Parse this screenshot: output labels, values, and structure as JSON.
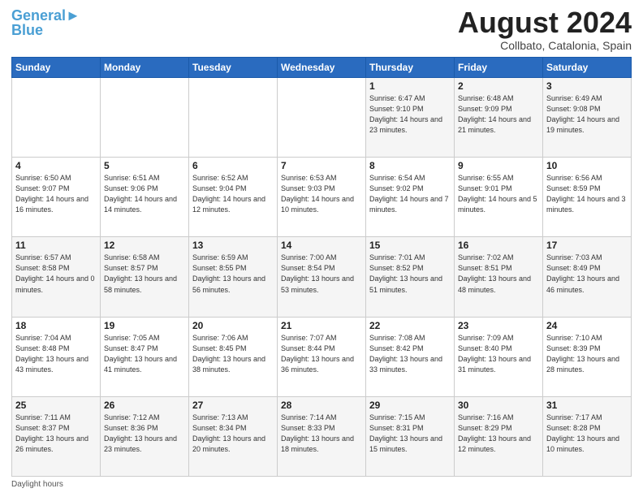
{
  "header": {
    "logo_line1": "General",
    "logo_line2": "Blue",
    "month_title": "August 2024",
    "location": "Collbato, Catalonia, Spain"
  },
  "days_of_week": [
    "Sunday",
    "Monday",
    "Tuesday",
    "Wednesday",
    "Thursday",
    "Friday",
    "Saturday"
  ],
  "weeks": [
    [
      {
        "day": "",
        "sunrise": "",
        "sunset": "",
        "daylight": ""
      },
      {
        "day": "",
        "sunrise": "",
        "sunset": "",
        "daylight": ""
      },
      {
        "day": "",
        "sunrise": "",
        "sunset": "",
        "daylight": ""
      },
      {
        "day": "",
        "sunrise": "",
        "sunset": "",
        "daylight": ""
      },
      {
        "day": "1",
        "sunrise": "Sunrise: 6:47 AM",
        "sunset": "Sunset: 9:10 PM",
        "daylight": "Daylight: 14 hours and 23 minutes."
      },
      {
        "day": "2",
        "sunrise": "Sunrise: 6:48 AM",
        "sunset": "Sunset: 9:09 PM",
        "daylight": "Daylight: 14 hours and 21 minutes."
      },
      {
        "day": "3",
        "sunrise": "Sunrise: 6:49 AM",
        "sunset": "Sunset: 9:08 PM",
        "daylight": "Daylight: 14 hours and 19 minutes."
      }
    ],
    [
      {
        "day": "4",
        "sunrise": "Sunrise: 6:50 AM",
        "sunset": "Sunset: 9:07 PM",
        "daylight": "Daylight: 14 hours and 16 minutes."
      },
      {
        "day": "5",
        "sunrise": "Sunrise: 6:51 AM",
        "sunset": "Sunset: 9:06 PM",
        "daylight": "Daylight: 14 hours and 14 minutes."
      },
      {
        "day": "6",
        "sunrise": "Sunrise: 6:52 AM",
        "sunset": "Sunset: 9:04 PM",
        "daylight": "Daylight: 14 hours and 12 minutes."
      },
      {
        "day": "7",
        "sunrise": "Sunrise: 6:53 AM",
        "sunset": "Sunset: 9:03 PM",
        "daylight": "Daylight: 14 hours and 10 minutes."
      },
      {
        "day": "8",
        "sunrise": "Sunrise: 6:54 AM",
        "sunset": "Sunset: 9:02 PM",
        "daylight": "Daylight: 14 hours and 7 minutes."
      },
      {
        "day": "9",
        "sunrise": "Sunrise: 6:55 AM",
        "sunset": "Sunset: 9:01 PM",
        "daylight": "Daylight: 14 hours and 5 minutes."
      },
      {
        "day": "10",
        "sunrise": "Sunrise: 6:56 AM",
        "sunset": "Sunset: 8:59 PM",
        "daylight": "Daylight: 14 hours and 3 minutes."
      }
    ],
    [
      {
        "day": "11",
        "sunrise": "Sunrise: 6:57 AM",
        "sunset": "Sunset: 8:58 PM",
        "daylight": "Daylight: 14 hours and 0 minutes."
      },
      {
        "day": "12",
        "sunrise": "Sunrise: 6:58 AM",
        "sunset": "Sunset: 8:57 PM",
        "daylight": "Daylight: 13 hours and 58 minutes."
      },
      {
        "day": "13",
        "sunrise": "Sunrise: 6:59 AM",
        "sunset": "Sunset: 8:55 PM",
        "daylight": "Daylight: 13 hours and 56 minutes."
      },
      {
        "day": "14",
        "sunrise": "Sunrise: 7:00 AM",
        "sunset": "Sunset: 8:54 PM",
        "daylight": "Daylight: 13 hours and 53 minutes."
      },
      {
        "day": "15",
        "sunrise": "Sunrise: 7:01 AM",
        "sunset": "Sunset: 8:52 PM",
        "daylight": "Daylight: 13 hours and 51 minutes."
      },
      {
        "day": "16",
        "sunrise": "Sunrise: 7:02 AM",
        "sunset": "Sunset: 8:51 PM",
        "daylight": "Daylight: 13 hours and 48 minutes."
      },
      {
        "day": "17",
        "sunrise": "Sunrise: 7:03 AM",
        "sunset": "Sunset: 8:49 PM",
        "daylight": "Daylight: 13 hours and 46 minutes."
      }
    ],
    [
      {
        "day": "18",
        "sunrise": "Sunrise: 7:04 AM",
        "sunset": "Sunset: 8:48 PM",
        "daylight": "Daylight: 13 hours and 43 minutes."
      },
      {
        "day": "19",
        "sunrise": "Sunrise: 7:05 AM",
        "sunset": "Sunset: 8:47 PM",
        "daylight": "Daylight: 13 hours and 41 minutes."
      },
      {
        "day": "20",
        "sunrise": "Sunrise: 7:06 AM",
        "sunset": "Sunset: 8:45 PM",
        "daylight": "Daylight: 13 hours and 38 minutes."
      },
      {
        "day": "21",
        "sunrise": "Sunrise: 7:07 AM",
        "sunset": "Sunset: 8:44 PM",
        "daylight": "Daylight: 13 hours and 36 minutes."
      },
      {
        "day": "22",
        "sunrise": "Sunrise: 7:08 AM",
        "sunset": "Sunset: 8:42 PM",
        "daylight": "Daylight: 13 hours and 33 minutes."
      },
      {
        "day": "23",
        "sunrise": "Sunrise: 7:09 AM",
        "sunset": "Sunset: 8:40 PM",
        "daylight": "Daylight: 13 hours and 31 minutes."
      },
      {
        "day": "24",
        "sunrise": "Sunrise: 7:10 AM",
        "sunset": "Sunset: 8:39 PM",
        "daylight": "Daylight: 13 hours and 28 minutes."
      }
    ],
    [
      {
        "day": "25",
        "sunrise": "Sunrise: 7:11 AM",
        "sunset": "Sunset: 8:37 PM",
        "daylight": "Daylight: 13 hours and 26 minutes."
      },
      {
        "day": "26",
        "sunrise": "Sunrise: 7:12 AM",
        "sunset": "Sunset: 8:36 PM",
        "daylight": "Daylight: 13 hours and 23 minutes."
      },
      {
        "day": "27",
        "sunrise": "Sunrise: 7:13 AM",
        "sunset": "Sunset: 8:34 PM",
        "daylight": "Daylight: 13 hours and 20 minutes."
      },
      {
        "day": "28",
        "sunrise": "Sunrise: 7:14 AM",
        "sunset": "Sunset: 8:33 PM",
        "daylight": "Daylight: 13 hours and 18 minutes."
      },
      {
        "day": "29",
        "sunrise": "Sunrise: 7:15 AM",
        "sunset": "Sunset: 8:31 PM",
        "daylight": "Daylight: 13 hours and 15 minutes."
      },
      {
        "day": "30",
        "sunrise": "Sunrise: 7:16 AM",
        "sunset": "Sunset: 8:29 PM",
        "daylight": "Daylight: 13 hours and 12 minutes."
      },
      {
        "day": "31",
        "sunrise": "Sunrise: 7:17 AM",
        "sunset": "Sunset: 8:28 PM",
        "daylight": "Daylight: 13 hours and 10 minutes."
      }
    ]
  ],
  "footer": {
    "note": "Daylight hours"
  }
}
